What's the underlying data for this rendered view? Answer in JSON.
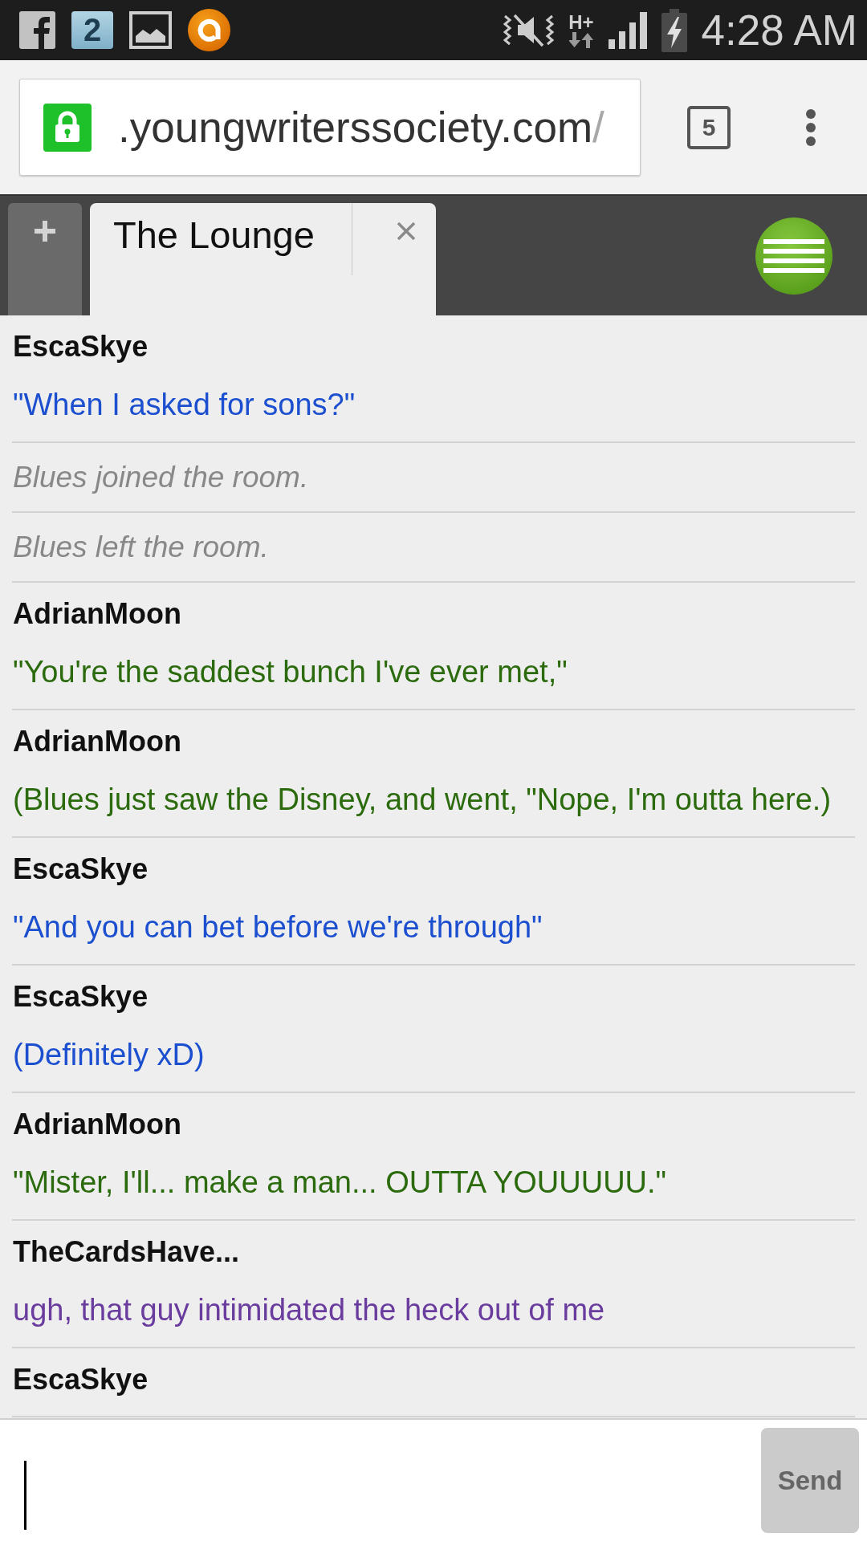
{
  "status_bar": {
    "calendar_day": "2",
    "network_type": "H+",
    "time": "4:28 AM"
  },
  "address_bar": {
    "secure": true,
    "url_host": ".youngwriterssociety.com",
    "url_path": "/",
    "tab_count": "5"
  },
  "tabs": [
    {
      "label": "The Lounge",
      "selected": true
    }
  ],
  "messages": [
    {
      "kind": "message",
      "user": "EscaSkye",
      "text": "\"When I asked for sons?\"",
      "color": "#1b4fcf"
    },
    {
      "kind": "event",
      "text": "Blues joined the room."
    },
    {
      "kind": "event",
      "text": "Blues left the room."
    },
    {
      "kind": "message",
      "user": "AdrianMoon",
      "text": "\"You're the saddest bunch I've ever met,\"",
      "color": "#2b6b0d"
    },
    {
      "kind": "message",
      "user": "AdrianMoon",
      "text": "(Blues just saw the Disney, and went, \"Nope, I'm outta here.)",
      "color": "#2b6b0d"
    },
    {
      "kind": "message",
      "user": "EscaSkye",
      "text": "\"And you can bet before we're through\"",
      "color": "#1b4fcf"
    },
    {
      "kind": "message",
      "user": "EscaSkye",
      "text": "(Definitely xD)",
      "color": "#1b4fcf"
    },
    {
      "kind": "message",
      "user": "AdrianMoon",
      "text": "\"Mister, I'll... make a man... OUTTA YOUUUUU.\"",
      "color": "#2b6b0d"
    },
    {
      "kind": "message",
      "user": "TheCardsHave...",
      "text": "ugh, that guy intimidated the heck out of me",
      "color": "#6a3c9e"
    },
    {
      "kind": "message",
      "user": "EscaSkye"
    }
  ],
  "composer": {
    "focused": true,
    "send_button": {
      "label": "Send",
      "disabled": true
    }
  }
}
